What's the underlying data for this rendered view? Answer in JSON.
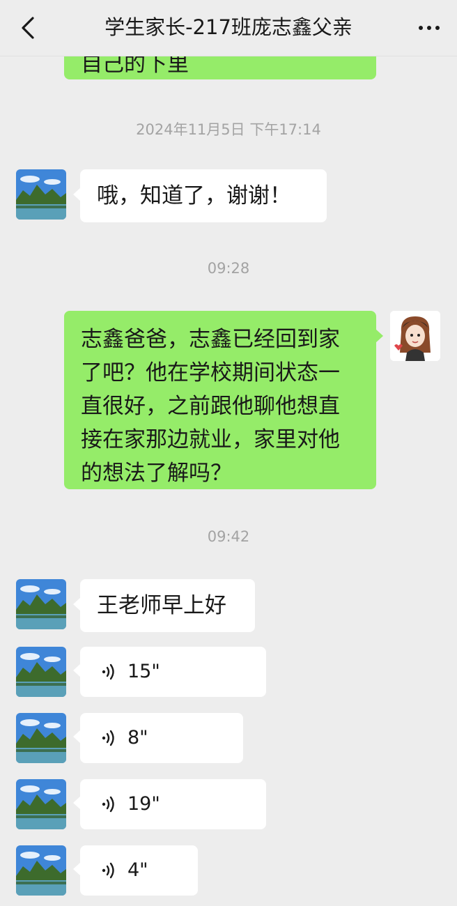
{
  "header": {
    "title": "学生家长-217班庞志鑫父亲",
    "back_icon": "chevron-left-icon",
    "more_icon": "ellipsis-icon"
  },
  "messages": {
    "partial_top_text": "自己的下里",
    "timestamp1": "2024年11月5日 下午17:14",
    "reply1": "哦，知道了，谢谢！",
    "timestamp2": "09:28",
    "teacher_msg_lines": [
      "志鑫爸爸，志鑫已经回到家",
      "了吧？他在学校期间状态一",
      "直很好，之前跟他聊他想直",
      "接在家那边就业，家里对他",
      "的想法了解吗？"
    ],
    "timestamp3": "09:42",
    "reply2": "王老师早上好",
    "voice1": "15\"",
    "voice2": "8\"",
    "voice3": "19\"",
    "voice4": "4\""
  },
  "colors": {
    "background": "#ededed",
    "sent_bubble": "#95ec69",
    "received_bubble": "#ffffff",
    "timestamp": "#a3a3a3"
  }
}
